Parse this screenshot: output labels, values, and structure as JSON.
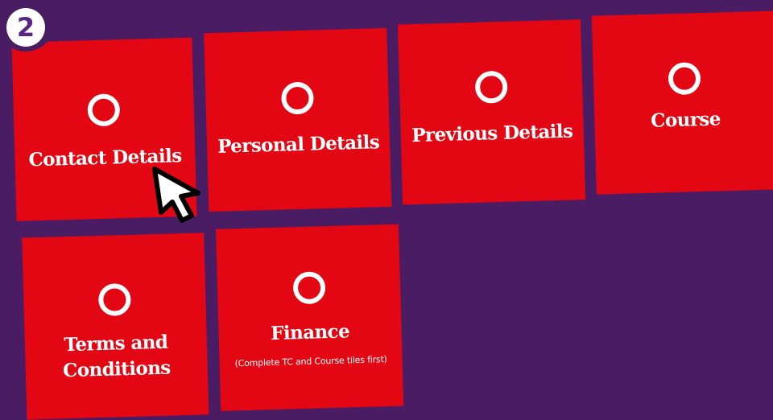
{
  "step_badge": {
    "number": "2"
  },
  "tiles": [
    {
      "label": "Contact Details"
    },
    {
      "label": "Personal Details"
    },
    {
      "label": "Previous Details"
    },
    {
      "label": "Course"
    },
    {
      "label_line1": "Terms and",
      "label_line2": "Conditions"
    },
    {
      "label": "Finance",
      "note": "(Complete TC and Course tiles first)"
    }
  ],
  "colors": {
    "background": "#4a1c63",
    "tile": "#e30613",
    "badge_text": "#5b2585"
  },
  "icons": {
    "status": "empty-circle-icon",
    "cursor": "mouse-pointer-icon"
  }
}
